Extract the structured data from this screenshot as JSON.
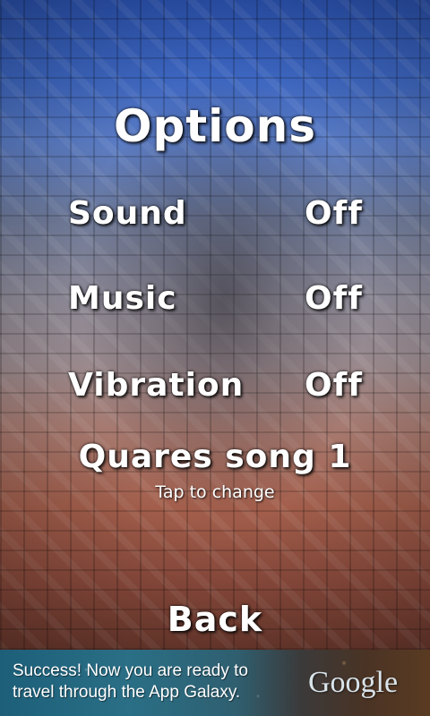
{
  "screen": {
    "title": "Options"
  },
  "options": [
    {
      "label": "Sound",
      "value": "Off"
    },
    {
      "label": "Music",
      "value": "Off"
    },
    {
      "label": "Vibration",
      "value": "Off"
    }
  ],
  "song": {
    "name": "Quares song 1",
    "hint": "Tap to change"
  },
  "back_label": "Back",
  "ad": {
    "text": "Success! Now you are ready to travel through the App Galaxy.",
    "logo": "Google"
  },
  "colors": {
    "text": "#ffffff",
    "ad_bg": "#2a6f86"
  }
}
